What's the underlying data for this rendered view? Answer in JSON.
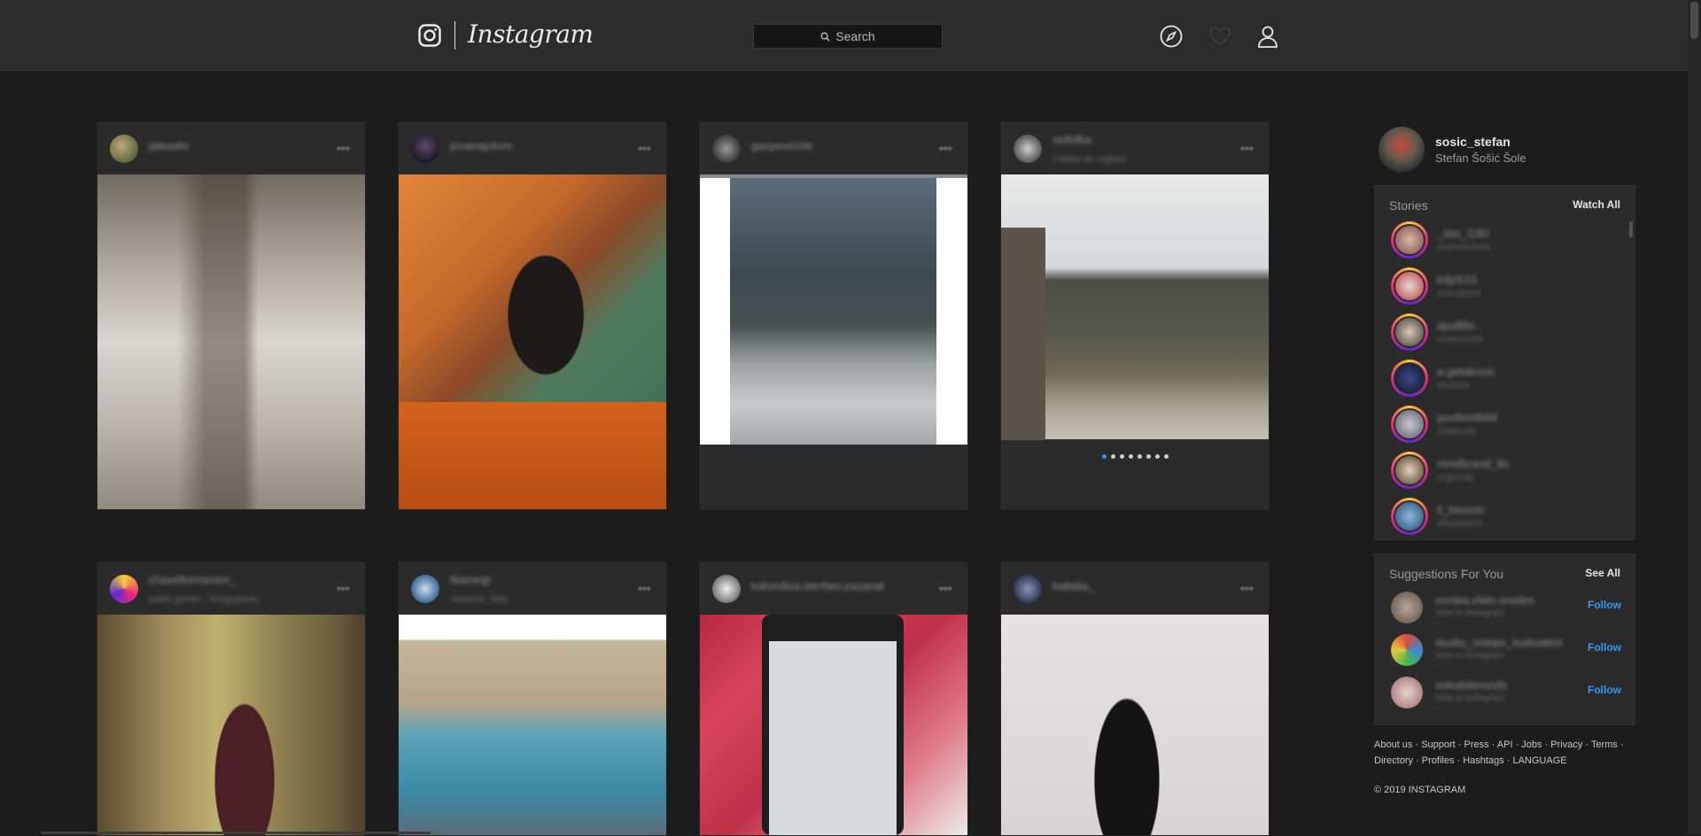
{
  "header": {
    "logo_icon": "instagram-camera-icon",
    "wordmark": "Instagram",
    "search_placeholder": "Search",
    "nav_icons": [
      "compass-icon",
      "heart-icon",
      "profile-icon"
    ]
  },
  "feed": [
    {
      "username": "jaleaalo",
      "location": ""
    },
    {
      "username": "jovanajotum",
      "location": ""
    },
    {
      "username": "gaspevinole",
      "location": ""
    },
    {
      "username": "velkifka",
      "location": "Caleta de vigliani"
    },
    {
      "username": "chavellonnenen_",
      "location": "walla gemer - Kragujevac"
    },
    {
      "username": "tkamegi",
      "location": "Venezia, Italy"
    },
    {
      "username": "kalondiva.sterfani.zazanal",
      "location": ""
    },
    {
      "username": "kaltalia_",
      "location": ""
    }
  ],
  "me": {
    "username": "sosic_stefan",
    "full_name": "Stefan Šošić Šole"
  },
  "stories": {
    "title": "Stories",
    "action": "Watch All",
    "items": [
      {
        "name": "_ilos_l180",
        "time": "pnenstrcdone"
      },
      {
        "name": "kdjz610",
        "time": "nintcobontt"
      },
      {
        "name": "apaflilic",
        "time": "noclnocerte"
      },
      {
        "name": "a.getakovic",
        "time": "nhulcine"
      },
      {
        "name": "poofeml948",
        "time": "11tlaluvds"
      },
      {
        "name": "ninelbraod_lin",
        "time": "nngcerigt"
      },
      {
        "name": "il_bevoric",
        "time": "alfcoodcent"
      }
    ]
  },
  "suggestions": {
    "title": "Suggestions For You",
    "action": "See All",
    "follow_label": "Follow",
    "items": [
      {
        "name": "vorska.clido.oredes",
        "note": "New to Instagram"
      },
      {
        "name": "studio_orieips_kodsolent",
        "note": "New to Instagram"
      },
      {
        "name": "solodoleronds",
        "note": "New to Instagram"
      }
    ]
  },
  "footer": {
    "line1": "About us · Support · Press · API · Jobs · Privacy · Terms ·",
    "line2": "Directory · Profiles · Hashtags · LANGUAGE",
    "copyright": "© 2019 INSTAGRAM"
  },
  "colors": {
    "page_bg": "#1c1c1c",
    "bar_bg": "#2c2c2c",
    "card_bg": "#2b2b2b",
    "link_blue": "#3897f0"
  }
}
